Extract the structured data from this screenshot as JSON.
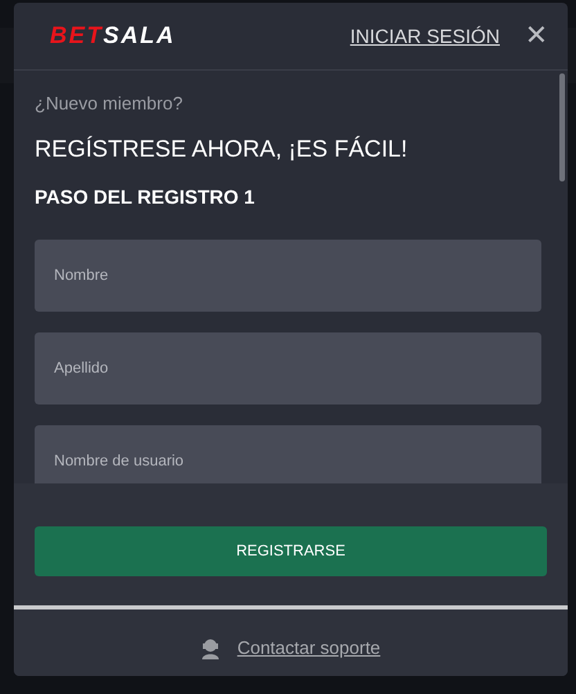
{
  "header": {
    "logo": [
      "BET",
      "SALA"
    ],
    "login_link": "INICIAR SESIÓN",
    "close": "✕"
  },
  "intro": {
    "subtitle": "¿Nuevo miembro?",
    "title": "REGÍSTRESE AHORA, ¡ES FÁCIL!",
    "step": "PASO DEL REGISTRO 1"
  },
  "fields": [
    {
      "placeholder": "Nombre"
    },
    {
      "placeholder": "Apellido"
    },
    {
      "placeholder": "Nombre de usuario"
    }
  ],
  "submit": "REGISTRARSE",
  "support_link": "Contactar soporte"
}
